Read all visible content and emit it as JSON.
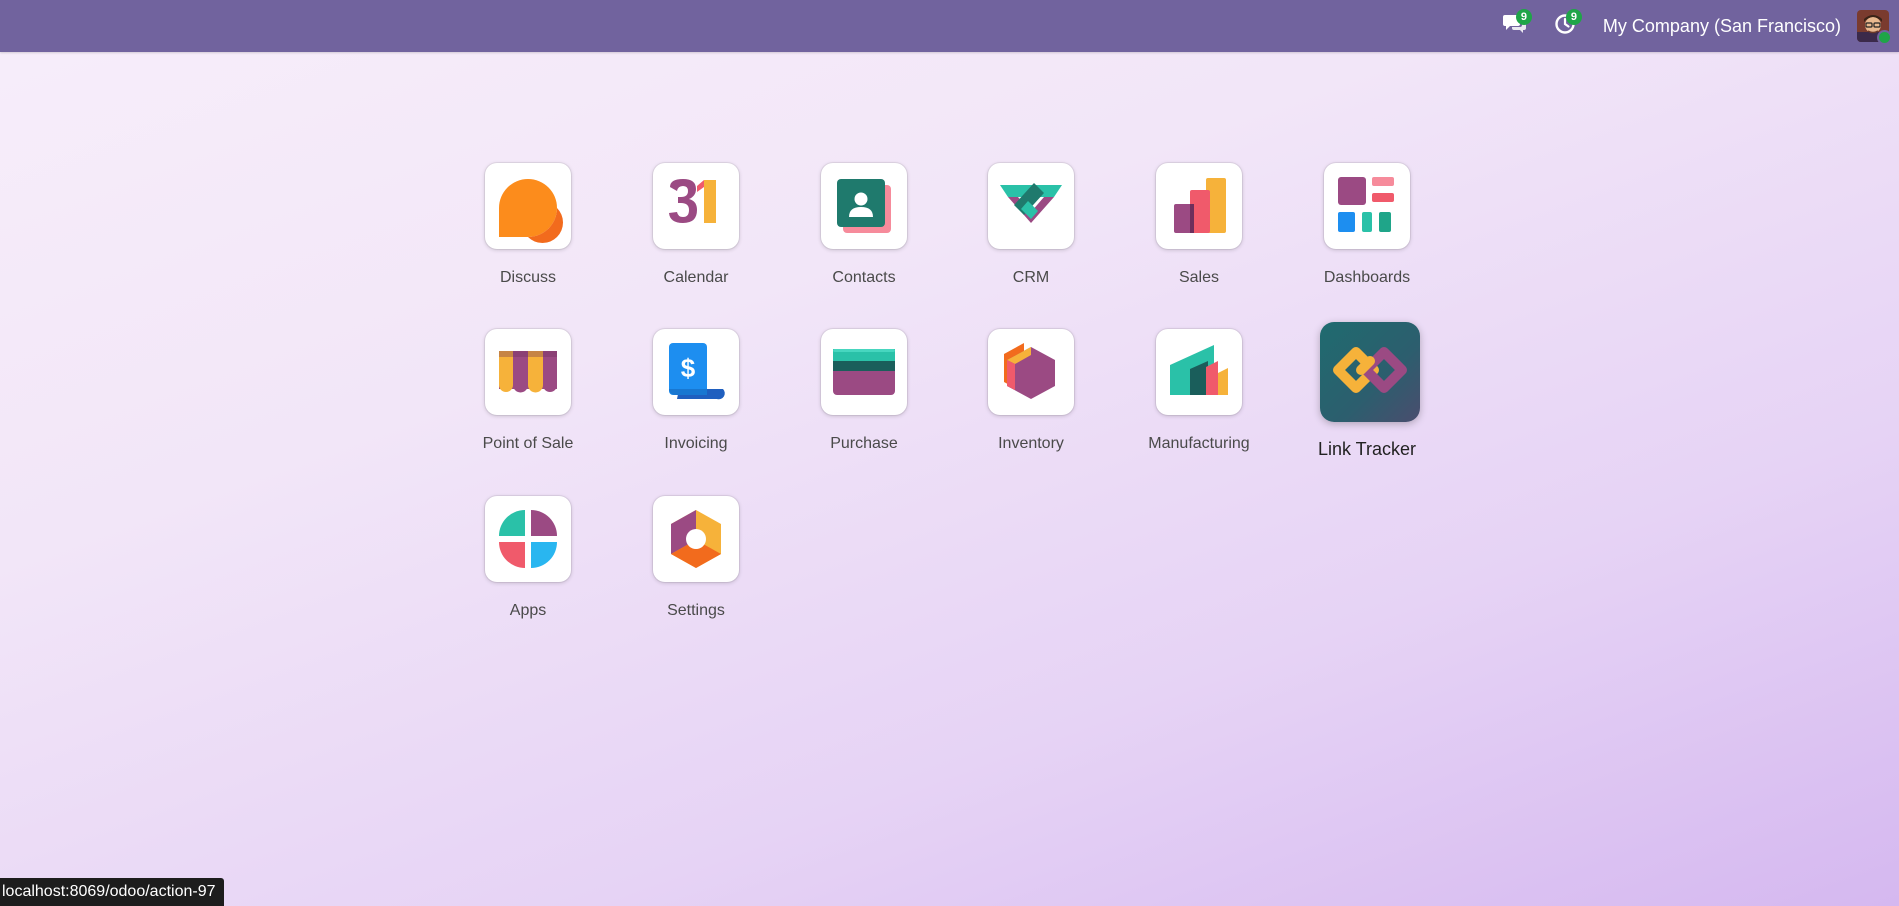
{
  "navbar": {
    "messages_badge": "9",
    "activities_badge": "9",
    "company": "My Company (San Francisco)"
  },
  "apps": [
    {
      "label": "Discuss",
      "icon": "discuss-icon"
    },
    {
      "label": "Calendar",
      "icon": "calendar-icon",
      "glyph": "31"
    },
    {
      "label": "Contacts",
      "icon": "contacts-icon"
    },
    {
      "label": "CRM",
      "icon": "crm-icon"
    },
    {
      "label": "Sales",
      "icon": "sales-icon"
    },
    {
      "label": "Dashboards",
      "icon": "dashboards-icon"
    },
    {
      "label": "Point of Sale",
      "icon": "point-of-sale-icon"
    },
    {
      "label": "Invoicing",
      "icon": "invoicing-icon",
      "glyph": "$"
    },
    {
      "label": "Purchase",
      "icon": "purchase-icon"
    },
    {
      "label": "Inventory",
      "icon": "inventory-icon"
    },
    {
      "label": "Manufacturing",
      "icon": "manufacturing-icon"
    },
    {
      "label": "Link Tracker",
      "icon": "link-tracker-icon",
      "hovered": true
    },
    {
      "label": "Apps",
      "icon": "apps-icon"
    },
    {
      "label": "Settings",
      "icon": "settings-icon"
    }
  ],
  "status_bar": {
    "url": "localhost:8069/odoo/action-97"
  },
  "colors": {
    "navbar": "#71639e",
    "badge": "#1fa548"
  }
}
